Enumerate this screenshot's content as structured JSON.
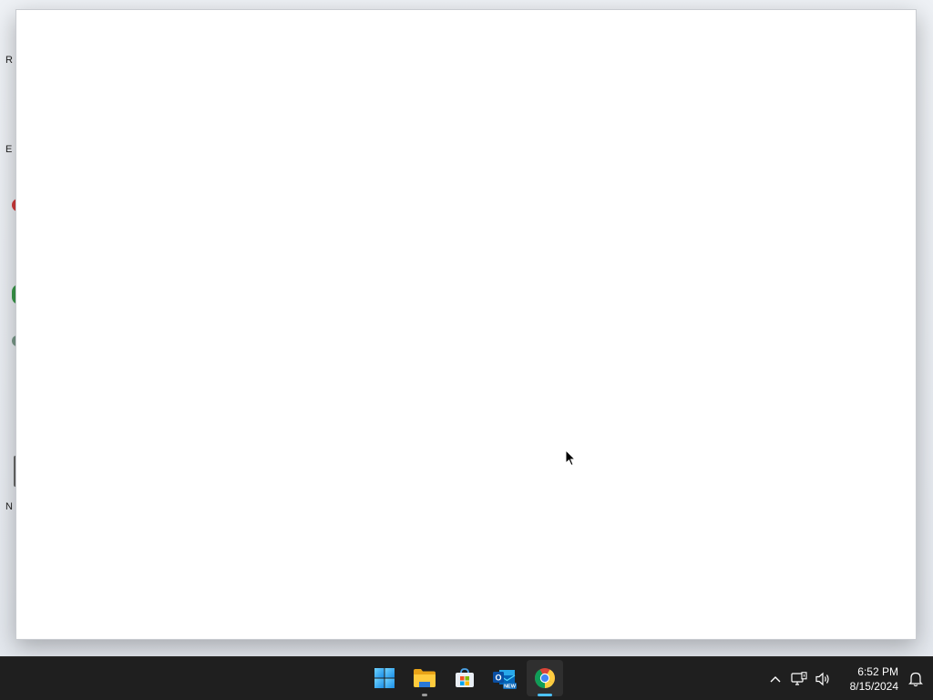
{
  "desktop": {
    "icon_label_stubs": [
      "R",
      "E",
      "N"
    ]
  },
  "taskbar": {
    "apps": [
      {
        "name": "Start",
        "icon": "windows-start-icon",
        "running": false,
        "active": false
      },
      {
        "name": "File Explorer",
        "icon": "folder-icon",
        "running": true,
        "active": false
      },
      {
        "name": "Microsoft Store",
        "icon": "store-bag-icon",
        "running": false,
        "active": false
      },
      {
        "name": "Outlook (new)",
        "icon": "outlook-icon",
        "running": false,
        "active": false
      },
      {
        "name": "Google Chrome",
        "icon": "chrome-icon",
        "running": true,
        "active": true
      }
    ],
    "outlook_badge": "NEW",
    "tray": {
      "overflow_icon": "chevron-up-icon",
      "network_icon": "network-icon",
      "volume_icon": "speaker-icon",
      "notification_icon": "bell-icon"
    },
    "clock": {
      "time": "6:52 PM",
      "date": "8/15/2024"
    }
  },
  "colors": {
    "taskbar_bg": "#1f1f1f",
    "active_indicator": "#4cc2ff",
    "window_bg": "#ffffff"
  }
}
